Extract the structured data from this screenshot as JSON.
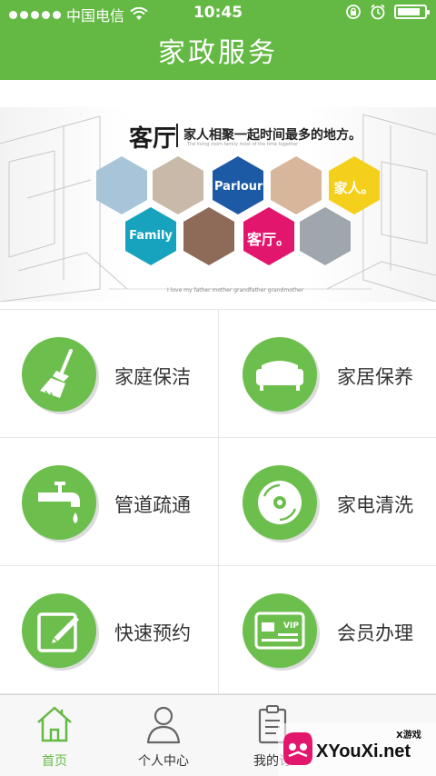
{
  "status_bar": {
    "carrier": "中国电信",
    "time": "10:45",
    "battery_level": 0.85,
    "icons": [
      "signal-dots-icon",
      "wifi-icon",
      "rotation-lock-icon",
      "alarm-icon",
      "battery-icon"
    ]
  },
  "header": {
    "title": "家政服务"
  },
  "banner": {
    "title": "客厅",
    "subtitle": "家人相聚一起时间最多的地方。",
    "tagline": "The living room family most of the time together",
    "footer": "I love my father  mother  grandfather grandmother",
    "hex_labels": [
      "Parlour",
      "家人。",
      "Family",
      "客厅。"
    ],
    "colors": {
      "blue": "#1d5aa6",
      "yellow": "#f4d01c",
      "teal": "#17a3bd",
      "pink": "#e3166d"
    }
  },
  "services": [
    {
      "label": "家庭保洁",
      "icon": "broom-icon"
    },
    {
      "label": "家居保养",
      "icon": "sofa-icon"
    },
    {
      "label": "管道疏通",
      "icon": "faucet-icon"
    },
    {
      "label": "家电清洗",
      "icon": "disc-icon"
    },
    {
      "label": "快速预约",
      "icon": "edit-icon"
    },
    {
      "label": "会员办理",
      "icon": "vip-card-icon"
    }
  ],
  "tabbar": {
    "tabs": [
      {
        "label": "首页",
        "icon": "home-icon",
        "active": true
      },
      {
        "label": "个人中心",
        "icon": "user-icon",
        "active": false
      },
      {
        "label": "我的订",
        "icon": "clipboard-icon",
        "active": false
      }
    ]
  },
  "watermark": {
    "site": "XYouXi.net",
    "small": "X游戏"
  },
  "colors": {
    "brand_green": "#64b944",
    "icon_green": "#6cbf4c"
  }
}
